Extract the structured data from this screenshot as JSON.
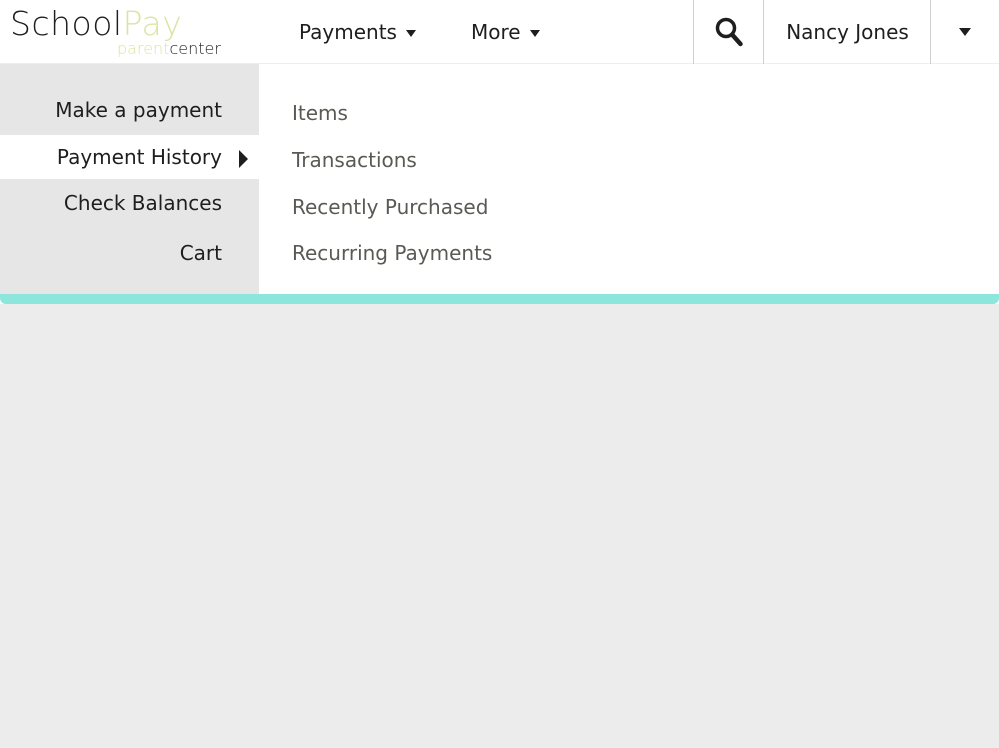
{
  "logo": {
    "school": "School",
    "pay": "Pay",
    "parent": "parent",
    "center": "center",
    "accent_color": "#d9e5a3"
  },
  "nav": {
    "payments_label": "Payments",
    "more_label": "More",
    "search_icon": "search-icon",
    "user_name": "Nancy Jones"
  },
  "left_menu": {
    "items": [
      {
        "label": "Make a payment"
      },
      {
        "label": "Payment History"
      },
      {
        "label": "Check Balances"
      },
      {
        "label": "Cart"
      }
    ],
    "active_index": 1
  },
  "submenu": {
    "items": [
      {
        "label": "Items"
      },
      {
        "label": "Transactions"
      },
      {
        "label": "Recently Purchased"
      },
      {
        "label": "Recurring Payments"
      }
    ]
  },
  "colors": {
    "accent_bar": "#8de6dc",
    "left_menu_bg": "#e6e6e6",
    "page_bg": "#ececec"
  }
}
